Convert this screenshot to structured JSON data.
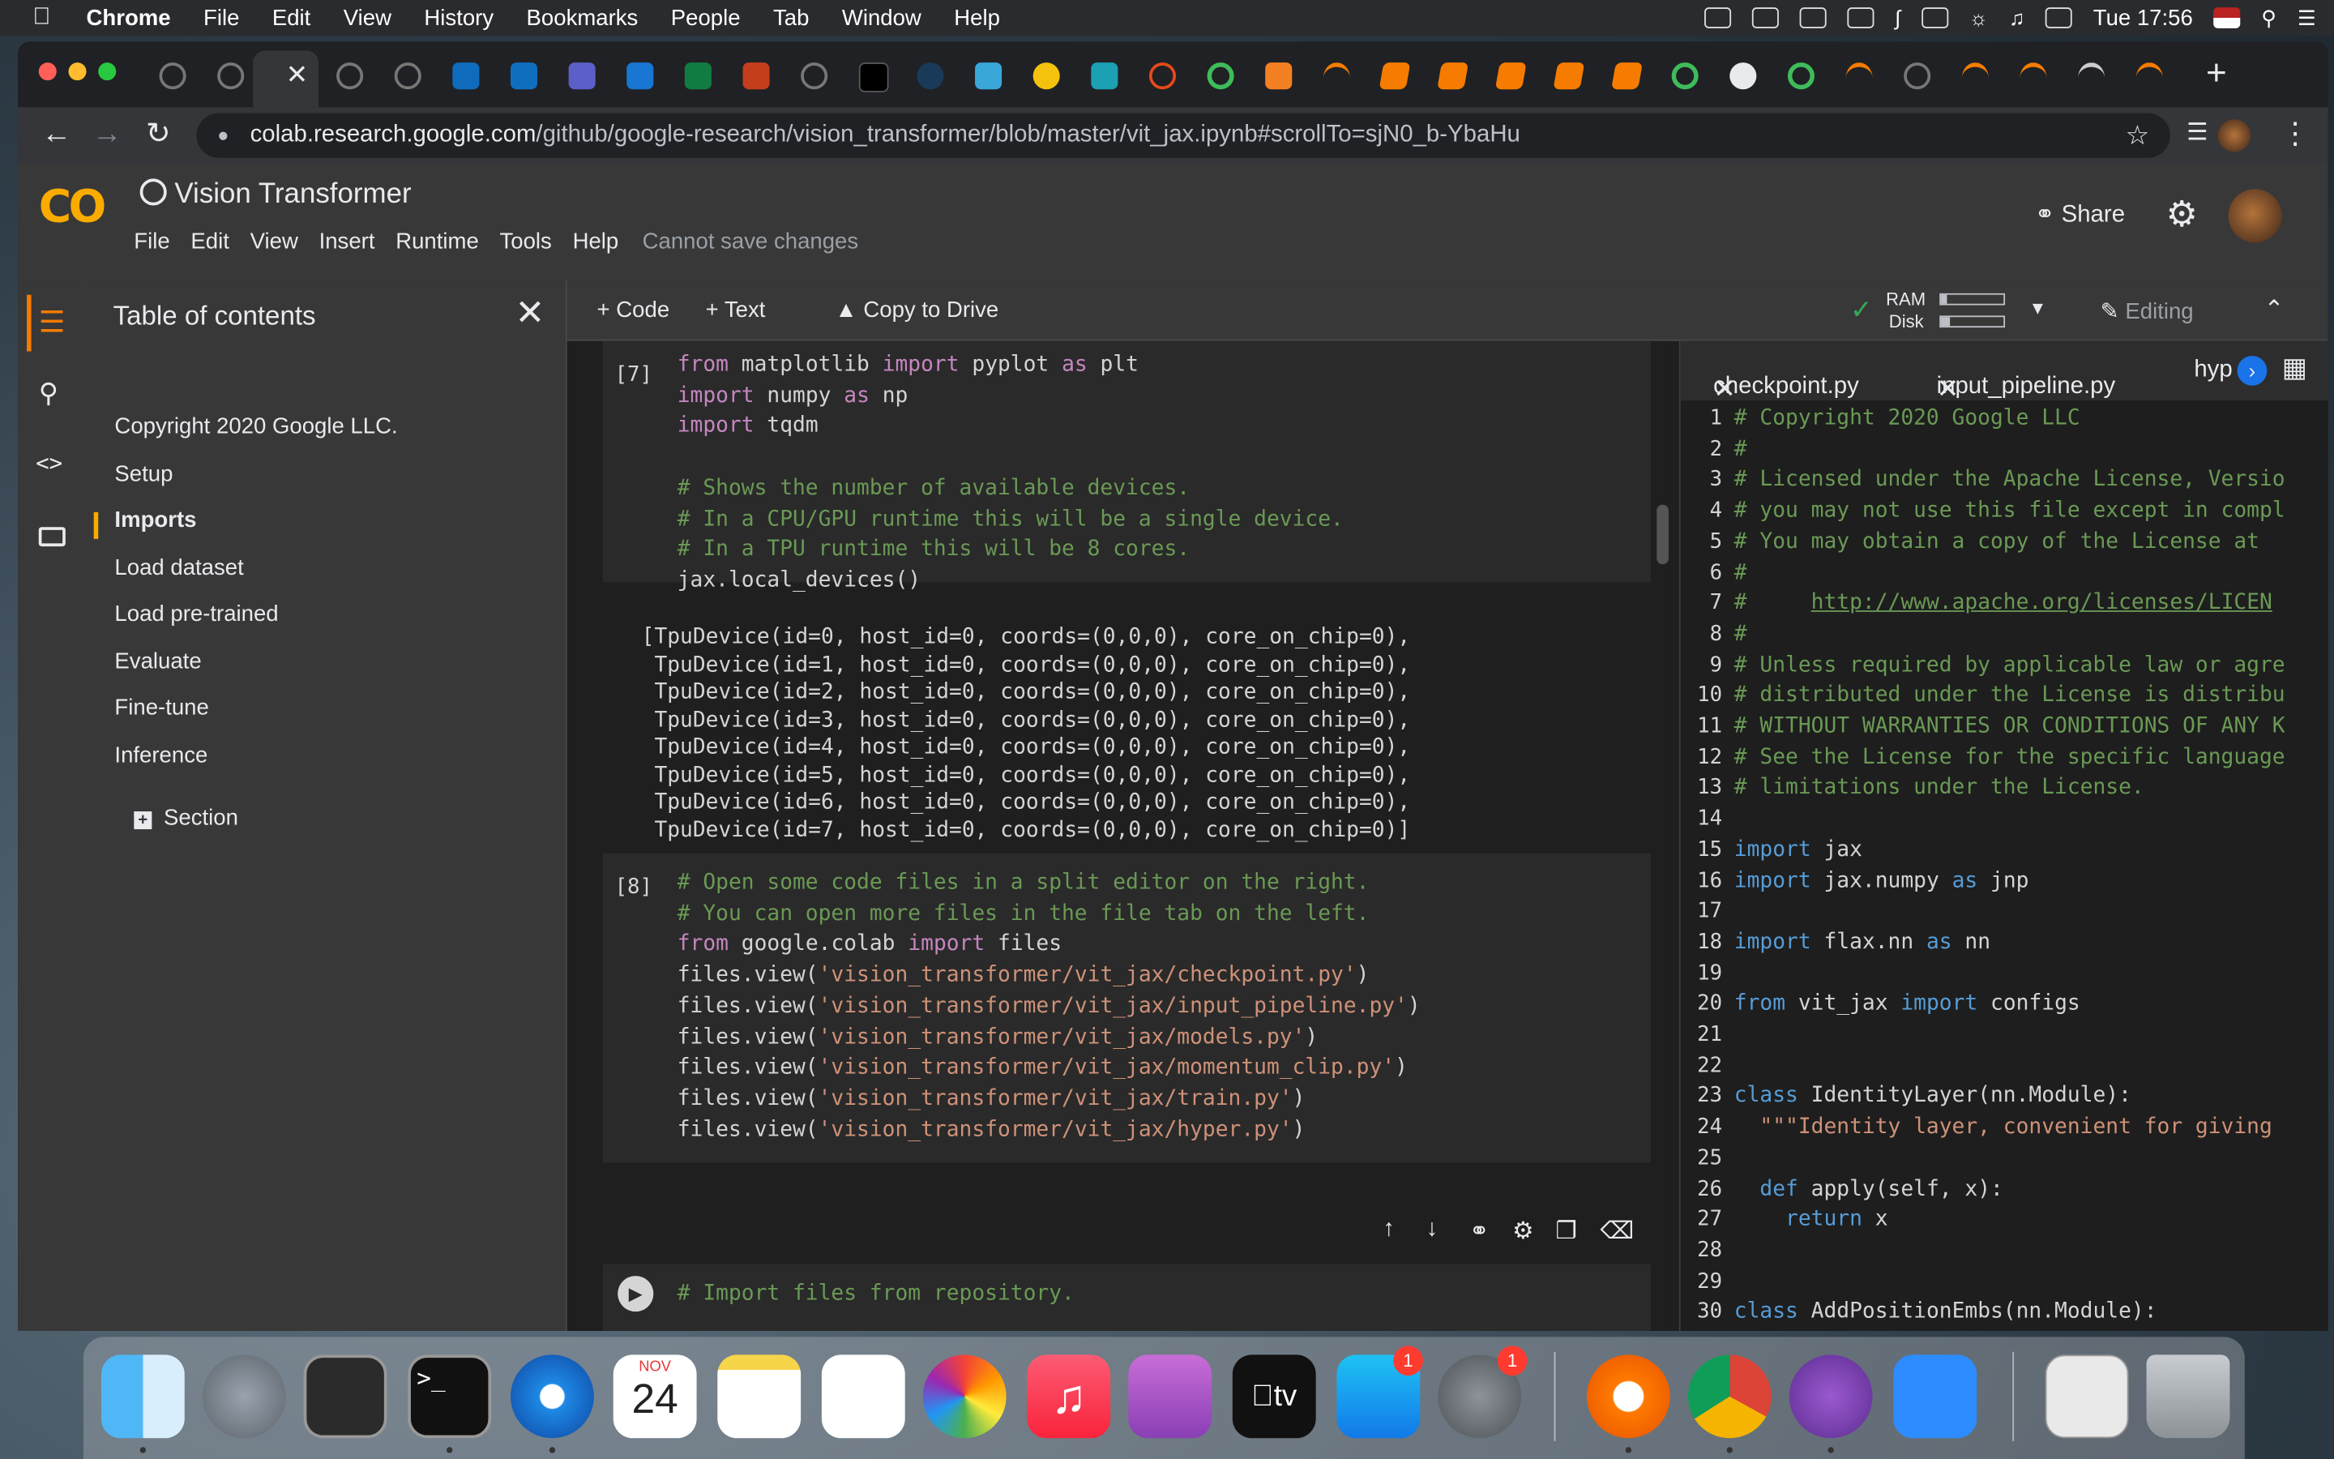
{
  "menubar": {
    "app": "Chrome",
    "items": [
      "File",
      "Edit",
      "View",
      "History",
      "Bookmarks",
      "People",
      "Tab",
      "Window",
      "Help"
    ],
    "clock": "Tue 17:56"
  },
  "browser": {
    "url_host": "colab.research.google.com",
    "url_path": "/github/google-research/vision_transformer/blob/master/vit_jax.ipynb#scrollTo=sjN0_b-YbaHu"
  },
  "colab": {
    "notebook_title": "Vision Transformer",
    "menus": [
      "File",
      "Edit",
      "View",
      "Insert",
      "Runtime",
      "Tools",
      "Help"
    ],
    "save_note": "Cannot save changes",
    "share_label": "Share",
    "toolbar": {
      "code": "+ Code",
      "text": "+ Text",
      "copy": "Copy to Drive",
      "ram": "RAM",
      "disk": "Disk",
      "editing": "Editing",
      "ram_fraction": 0.1,
      "disk_fraction": 0.15
    },
    "toc": {
      "title": "Table of contents",
      "items": [
        "Copyright 2020 Google LLC.",
        "Setup",
        "Imports",
        "Load dataset",
        "Load pre-trained",
        "Evaluate",
        "Fine-tune",
        "Inference"
      ],
      "selected": "Imports",
      "section": "Section"
    }
  },
  "cells": {
    "cell7": {
      "prompt": "[7]",
      "lines": [
        "from matplotlib import pyplot as plt",
        "import numpy as np",
        "import tqdm",
        "",
        "# Shows the number of available devices.",
        "# In a CPU/GPU runtime this will be a single device.",
        "# In a TPU runtime this will be 8 cores.",
        "jax.local_devices()"
      ],
      "output": [
        "[TpuDevice(id=0, host_id=0, coords=(0,0,0), core_on_chip=0),",
        " TpuDevice(id=1, host_id=0, coords=(0,0,0), core_on_chip=0),",
        " TpuDevice(id=2, host_id=0, coords=(0,0,0), core_on_chip=0),",
        " TpuDevice(id=3, host_id=0, coords=(0,0,0), core_on_chip=0),",
        " TpuDevice(id=4, host_id=0, coords=(0,0,0), core_on_chip=0),",
        " TpuDevice(id=5, host_id=0, coords=(0,0,0), core_on_chip=0),",
        " TpuDevice(id=6, host_id=0, coords=(0,0,0), core_on_chip=0),",
        " TpuDevice(id=7, host_id=0, coords=(0,0,0), core_on_chip=0)]"
      ]
    },
    "cell8": {
      "prompt": "[8]",
      "lines": [
        "# Open some code files in a split editor on the right.",
        "# You can open more files in the file tab on the left.",
        "from google.colab import files",
        "files.view('vision_transformer/vit_jax/checkpoint.py')",
        "files.view('vision_transformer/vit_jax/input_pipeline.py')",
        "files.view('vision_transformer/vit_jax/models.py')",
        "files.view('vision_transformer/vit_jax/momentum_clip.py')",
        "files.view('vision_transformer/vit_jax/train.py')",
        "files.view('vision_transformer/vit_jax/hyper.py')"
      ]
    },
    "cell9": {
      "lines": [
        "# Import files from repository."
      ]
    }
  },
  "editor": {
    "tabs": [
      "checkpoint.py",
      "input_pipeline.py",
      "hyp"
    ],
    "lines": [
      "# Copyright 2020 Google LLC",
      "#",
      "# Licensed under the Apache License, Versio",
      "# you may not use this file except in compl",
      "# You may obtain a copy of the License at",
      "#",
      "#     http://www.apache.org/licenses/LICEN",
      "#",
      "# Unless required by applicable law or agre",
      "# distributed under the License is distribu",
      "# WITHOUT WARRANTIES OR CONDITIONS OF ANY K",
      "# See the License for the specific language",
      "# limitations under the License.",
      "",
      "import jax",
      "import jax.numpy as jnp",
      "",
      "import flax.nn as nn",
      "",
      "from vit_jax import configs",
      "",
      "",
      "class IdentityLayer(nn.Module):",
      "  \"\"\"Identity layer, convenient for giving ",
      "",
      "  def apply(self, x):",
      "    return x",
      "",
      "",
      "class AddPositionEmbs(nn.Module):"
    ]
  },
  "dock": {
    "calendar_month": "NOV",
    "calendar_day": "24",
    "badge_appstore": "1",
    "badge_prefs": "1",
    "tv_label": "tv"
  },
  "colors": {
    "accent_orange": "#f9ab00",
    "keyword": "#c586c0",
    "comment": "#6a9955",
    "string": "#ce9178"
  }
}
